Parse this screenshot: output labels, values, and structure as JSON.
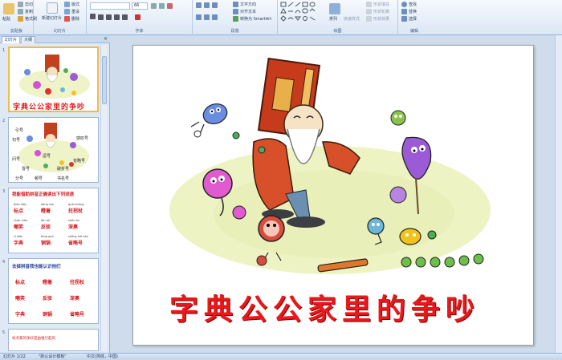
{
  "ribbon": {
    "groups": [
      {
        "id": "clipboard",
        "label": "剪贴板",
        "items": [
          "剪切",
          "复制",
          "格式刷"
        ],
        "paste": "粘贴"
      },
      {
        "id": "slides",
        "label": "幻灯片",
        "new_slide": "新建幻灯片",
        "items": [
          "版式",
          "重设",
          "删除"
        ]
      },
      {
        "id": "font",
        "label": "字体",
        "size": "66"
      },
      {
        "id": "paragraph",
        "label": "段落",
        "items": [
          "文字方向",
          "对齐文本",
          "转换为 SmartArt"
        ]
      },
      {
        "id": "drawing",
        "label": "绘图",
        "arrange": "排列",
        "quick_styles": "快速样式",
        "items": [
          "形状填充",
          "形状轮廓",
          "形状效果"
        ]
      },
      {
        "id": "editing",
        "label": "编辑",
        "items": [
          "查找",
          "替换",
          "选择"
        ]
      }
    ]
  },
  "panel": {
    "tabs": [
      "幻灯片",
      "大纲"
    ],
    "close": "×",
    "thumbs": [
      {
        "num": "1",
        "title": "字典公公家里的争吵"
      },
      {
        "num": "2",
        "labels": [
          "引号",
          "句号",
          "问号",
          "冒号",
          "逗号",
          "感叹号",
          "省略号",
          "书名号",
          "破折号",
          "分号",
          "顿号"
        ]
      },
      {
        "num": "3",
        "heading": "我能借助拼音正确读出下列词语",
        "rows": [
          [
            {
              "py": "biāo diǎn",
              "hz": "标点"
            },
            {
              "py": "dèng zhe",
              "hz": "瞪着"
            },
            {
              "py": "guǎi zhàng",
              "hz": "拄拐杖"
            }
          ],
          [
            {
              "py": "cháo xiào",
              "hz": "嘲笑"
            },
            {
              "py": "fǎn bó",
              "hz": "反驳"
            },
            {
              "py": "shēn ào",
              "hz": "深奥"
            }
          ],
          [
            {
              "py": "zì diǎn",
              "hz": "字典"
            },
            {
              "py": "tóng guō",
              "hz": "铜锅"
            },
            {
              "py": "shěng lüè hào",
              "hz": "省略号"
            }
          ]
        ]
      },
      {
        "num": "4",
        "heading": "去掉拼音我也能认识他们",
        "rows": [
          [
            "标点",
            "瞪着",
            "拄拐杖"
          ],
          [
            "嘲笑",
            "反驳",
            "深奥"
          ],
          [
            "字典",
            "铜锅",
            "省略号"
          ]
        ]
      },
      {
        "num": "5",
        "heading": "标点家的争吵是由谁引起的"
      }
    ]
  },
  "slide": {
    "title": "字典公公家里的争吵"
  },
  "status": {
    "slide_counter": "幻灯片 1/22",
    "theme": "\"默认设计模板\"",
    "language": "中文(简体，中国)"
  },
  "colors": {
    "title_red": "#e8191c",
    "selection": "#f5b946",
    "ribbon_border": "#8db2e3"
  }
}
